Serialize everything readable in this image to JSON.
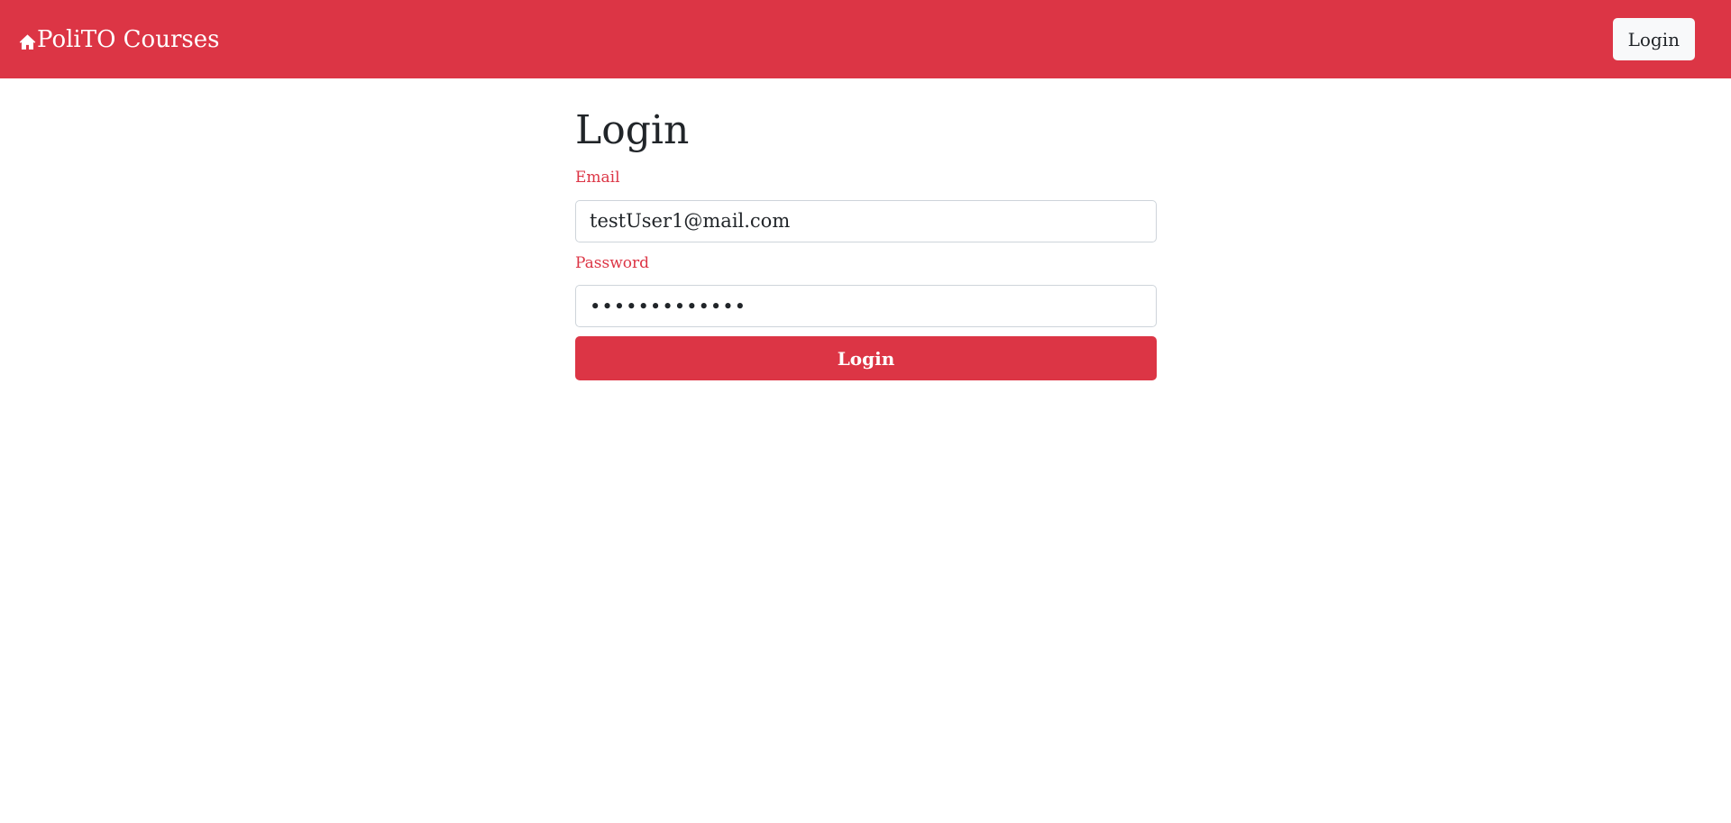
{
  "navbar": {
    "brand_text": "PoliTO Courses",
    "brand_icon": "house-icon",
    "login_button": "Login",
    "background_color": "#dc3545"
  },
  "main": {
    "title": "Login",
    "email": {
      "label": "Email",
      "value": "testUser1@mail.com"
    },
    "password": {
      "label": "Password",
      "value": "•••••••••••••"
    },
    "submit_label": "Login"
  },
  "colors": {
    "accent": "#dc3545",
    "label": "#dc3545",
    "nav_button_bg": "#f8f9fa"
  }
}
